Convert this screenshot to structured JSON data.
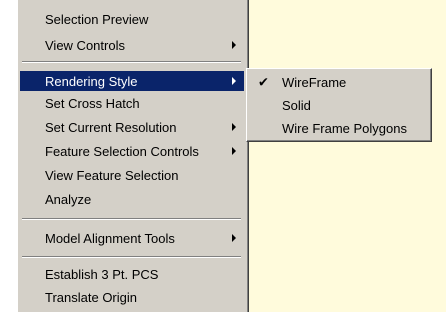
{
  "menu": {
    "group1": [
      {
        "label": "Selection Preview",
        "has_submenu": false
      },
      {
        "label": "View Controls",
        "has_submenu": true
      }
    ],
    "group2": [
      {
        "label": "Rendering Style",
        "has_submenu": true,
        "highlighted": true
      },
      {
        "label": "Set Cross Hatch",
        "has_submenu": false
      },
      {
        "label": "Set Current Resolution",
        "has_submenu": true
      },
      {
        "label": "Feature Selection Controls",
        "has_submenu": true
      },
      {
        "label": "View Feature Selection",
        "has_submenu": false
      },
      {
        "label": "Analyze",
        "has_submenu": false
      }
    ],
    "group3": [
      {
        "label": "Model Alignment Tools",
        "has_submenu": true
      }
    ],
    "group4": [
      {
        "label": "Establish 3 Pt. PCS",
        "has_submenu": false
      },
      {
        "label": "Translate Origin",
        "has_submenu": false
      }
    ]
  },
  "submenu": {
    "items": [
      {
        "label": "WireFrame",
        "checked": true
      },
      {
        "label": "Solid",
        "checked": false
      },
      {
        "label": "Wire Frame Polygons",
        "checked": false
      }
    ],
    "check_glyph": "✔"
  },
  "colors": {
    "menu_bg": "#d4d0c8",
    "highlight_bg": "#0a246a",
    "document_bg": "#fffbdc"
  }
}
